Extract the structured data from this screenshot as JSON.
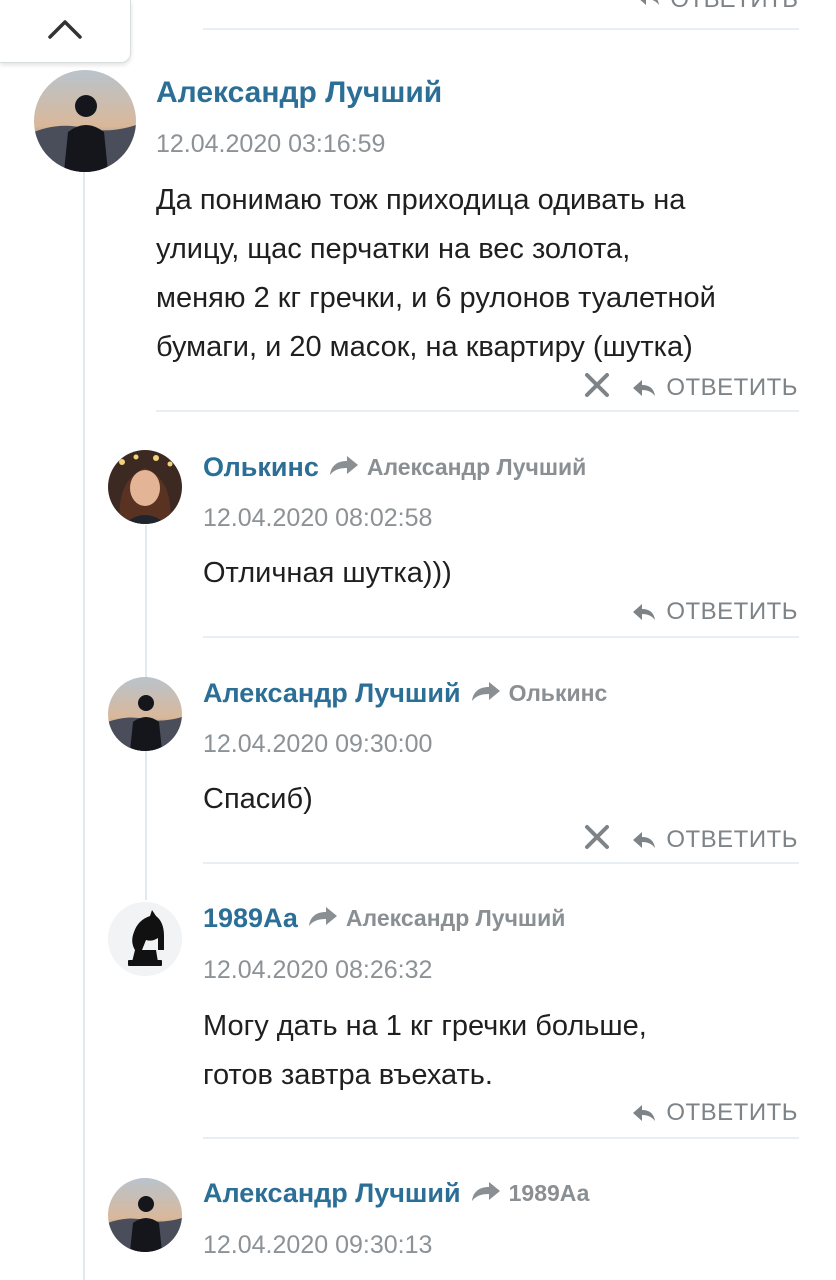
{
  "scroll_top_button": {
    "icon": "chevron-up-icon"
  },
  "top_reply_label": "ОТВЕТИТЬ",
  "colors": {
    "author": "#2b6f96",
    "muted": "#8c9296",
    "divider": "#e8eef1"
  },
  "comments": [
    {
      "author": "Александр Лучший",
      "reply_to": "",
      "date": "12.04.2020 03:16:59",
      "text_lines": [
        "Да понимаю тож приходица одивать на",
        "улицу, щас перчатки на вес золота,",
        "меняю 2 кг гречки, и 6 рулонов туалетной",
        "бумаги, и 20 масок, на квартиру (шутка)"
      ],
      "reply_label": "ОТВЕТИТЬ",
      "avatar": "sunset-silhouette"
    },
    {
      "author": "Олькинс",
      "reply_to": "Александр Лучший",
      "date": "12.04.2020 08:02:58",
      "text_lines": [
        "Отличная шутка)))"
      ],
      "reply_label": "ОТВЕТИТЬ",
      "avatar": "woman-portrait"
    },
    {
      "author": "Александр Лучший",
      "reply_to": "Олькинс",
      "date": "12.04.2020 09:30:00",
      "text_lines": [
        "Спасиб)"
      ],
      "reply_label": "ОТВЕТИТЬ",
      "avatar": "sunset-silhouette"
    },
    {
      "author": "1989Аа",
      "reply_to": "Александр Лучший",
      "date": "12.04.2020 08:26:32",
      "text_lines": [
        "Могу дать на 1 кг гречки больше,",
        "готов завтра въехать."
      ],
      "reply_label": "ОТВЕТИТЬ",
      "avatar": "chess-knight"
    },
    {
      "author": "Александр Лучший",
      "reply_to": "1989Аа",
      "date": "12.04.2020 09:30:13",
      "text_lines": [],
      "reply_label": "",
      "avatar": "sunset-silhouette"
    }
  ]
}
